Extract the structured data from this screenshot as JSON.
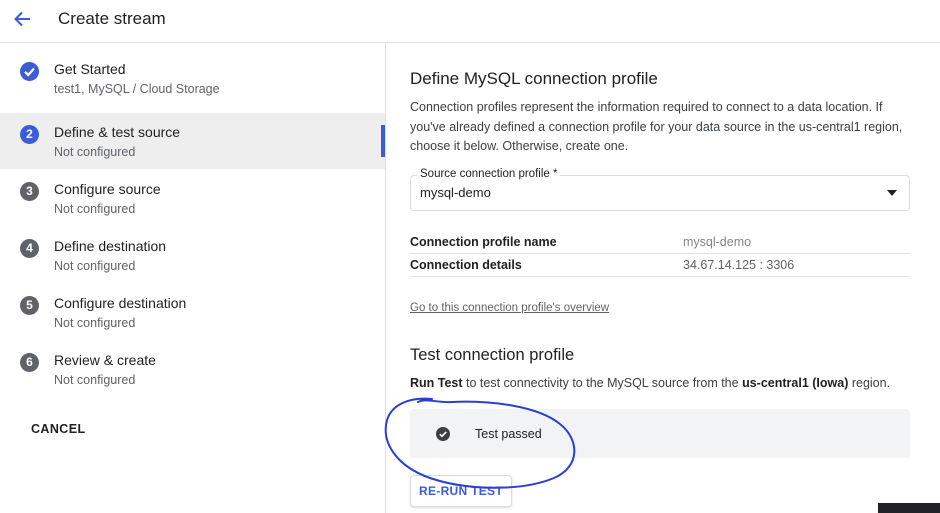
{
  "header": {
    "title": "Create stream",
    "back_icon": "arrow-back-icon"
  },
  "steps": [
    {
      "number": "1",
      "label": "Get Started",
      "sub": "test1, MySQL / Cloud Storage",
      "state": "done"
    },
    {
      "number": "2",
      "label": "Define & test source",
      "sub": "Not configured",
      "state": "active"
    },
    {
      "number": "3",
      "label": "Configure source",
      "sub": "Not configured",
      "state": "pending"
    },
    {
      "number": "4",
      "label": "Define destination",
      "sub": "Not configured",
      "state": "pending"
    },
    {
      "number": "5",
      "label": "Configure destination",
      "sub": "Not configured",
      "state": "pending"
    },
    {
      "number": "6",
      "label": "Review & create",
      "sub": "Not configured",
      "state": "pending"
    }
  ],
  "sidebar": {
    "cancel_label": "CANCEL"
  },
  "main": {
    "title": "Define MySQL connection profile",
    "description": "Connection profiles represent the information required to connect to a data location. If you've already defined a connection profile for your data source in the us-central1 region, choose it below. Otherwise, create one.",
    "profile_select": {
      "label": "Source connection profile *",
      "value": "mysql-demo"
    },
    "details": [
      {
        "key": "Connection profile name",
        "value": "mysql-demo"
      },
      {
        "key": "Connection details",
        "value": "34.67.14.125 : 3306"
      }
    ],
    "overview_link": "Go to this connection profile's overview",
    "test_title": "Test connection profile",
    "run_test": {
      "prefix_bold": "Run Test",
      "middle": " to test connectivity to the MySQL source from the ",
      "region_bold": "us-central1 (Iowa)",
      "suffix": " region."
    },
    "test_result": "Test passed",
    "rerun_label": "RE-RUN TEST"
  },
  "colors": {
    "accent": "#3c5bd6",
    "annotation": "#2a3fd1"
  }
}
